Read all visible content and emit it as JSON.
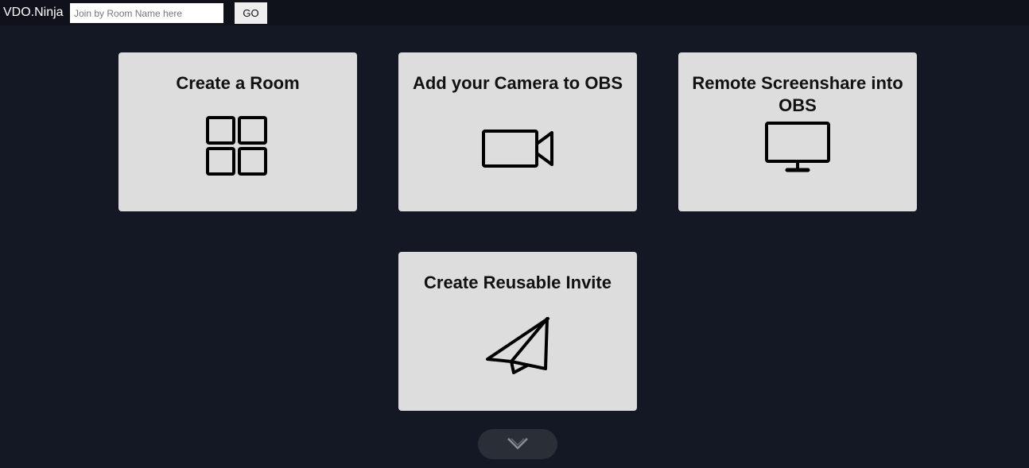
{
  "header": {
    "brand": "VDO.Ninja",
    "join_placeholder": "Join by Room Name here",
    "go_label": "GO"
  },
  "cards": [
    {
      "id": "room",
      "title": "Create a Room",
      "icon": "grid-icon"
    },
    {
      "id": "camera",
      "title": "Add your Camera to OBS",
      "icon": "video-camera-icon"
    },
    {
      "id": "screen",
      "title": "Remote Screenshare into OBS",
      "icon": "monitor-icon"
    },
    {
      "id": "invite",
      "title": "Create Reusable Invite",
      "icon": "paper-plane-icon"
    }
  ],
  "scroll": {
    "icon": "chevron-down-icon"
  },
  "colors": {
    "background": "#141824",
    "topbar": "#0f121b",
    "card": "#dddddd",
    "text": "#111111"
  }
}
